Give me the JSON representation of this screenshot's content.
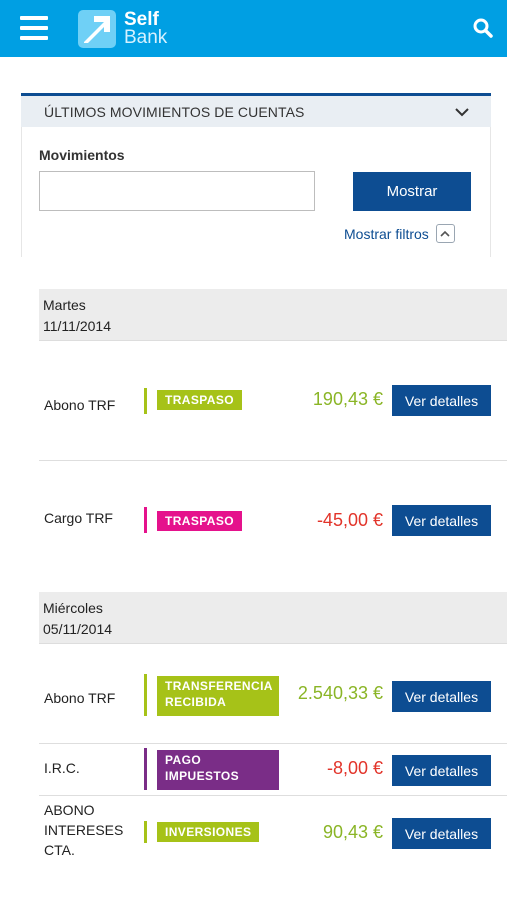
{
  "header": {
    "brand_line1": "Self",
    "brand_line2": "Bank",
    "icons": {
      "menu": "hamburger-icon",
      "search": "search-icon",
      "logo": "selfbank-arrow-logo"
    }
  },
  "panel": {
    "title": "ÚLTIMOS MOVIMIENTOS DE CUENTAS",
    "movimientos_label": "Movimientos",
    "movimientos_value": "",
    "mostrar_label": "Mostrar",
    "filtros_label": "Mostrar filtros"
  },
  "colors": {
    "brand_blue": "#009fe3",
    "dark_blue": "#0d4d92",
    "positive": "#8ab526",
    "negative": "#e2342a",
    "traspaso_pos": "#a6c218",
    "traspaso_neg": "#e5128c",
    "impuestos": "#7a2d87"
  },
  "days": [
    {
      "weekday": "Martes",
      "date": "11/11/2014",
      "items": [
        {
          "concept": "Abono TRF",
          "tag": "TRASPASO",
          "amount": "190,43 €",
          "button": "Ver detalles"
        },
        {
          "concept": "Cargo TRF",
          "tag": "TRASPASO",
          "amount": "-45,00 €",
          "button": "Ver detalles"
        }
      ]
    },
    {
      "weekday": "Miércoles",
      "date": "05/11/2014",
      "items": [
        {
          "concept": "Abono TRF",
          "tag": "TRANSFERENCIA RECIBIDA",
          "amount": "2.540,33 €",
          "button": "Ver detalles"
        },
        {
          "concept": "I.R.C.",
          "tag": "PAGO IMPUESTOS",
          "amount": "-8,00 €",
          "button": "Ver detalles"
        },
        {
          "concept": "ABONO INTERESES CTA.",
          "tag": "INVERSIONES",
          "amount": "90,43 €",
          "button": "Ver detalles"
        }
      ]
    }
  ]
}
